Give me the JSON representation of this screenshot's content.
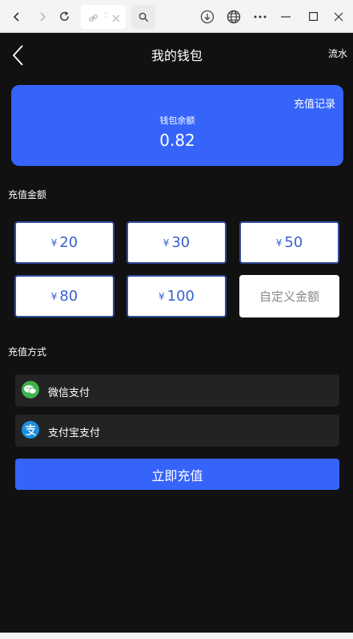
{
  "browser": {
    "address_dots": ":"
  },
  "header": {
    "title": "我的钱包",
    "flow_label": "流水"
  },
  "wallet": {
    "records_label": "充值记录",
    "balance_label": "钱包余额",
    "balance_value": "0.82"
  },
  "recharge_amount": {
    "section_label": "充值金额",
    "currency_symbol": "¥",
    "options": [
      "20",
      "30",
      "50",
      "80",
      "100"
    ],
    "custom_placeholder": "自定义金额"
  },
  "payment": {
    "section_label": "充值方式",
    "methods": [
      {
        "label": "微信支付",
        "icon": "wechat-pay-icon",
        "color": "#3db34a"
      },
      {
        "label": "支付宝支付",
        "icon": "alipay-icon",
        "color": "#1a8fe0"
      }
    ]
  },
  "submit_label": "立即充值",
  "colors": {
    "accent": "#3664fb",
    "background": "#111112",
    "row_background": "#232323"
  }
}
